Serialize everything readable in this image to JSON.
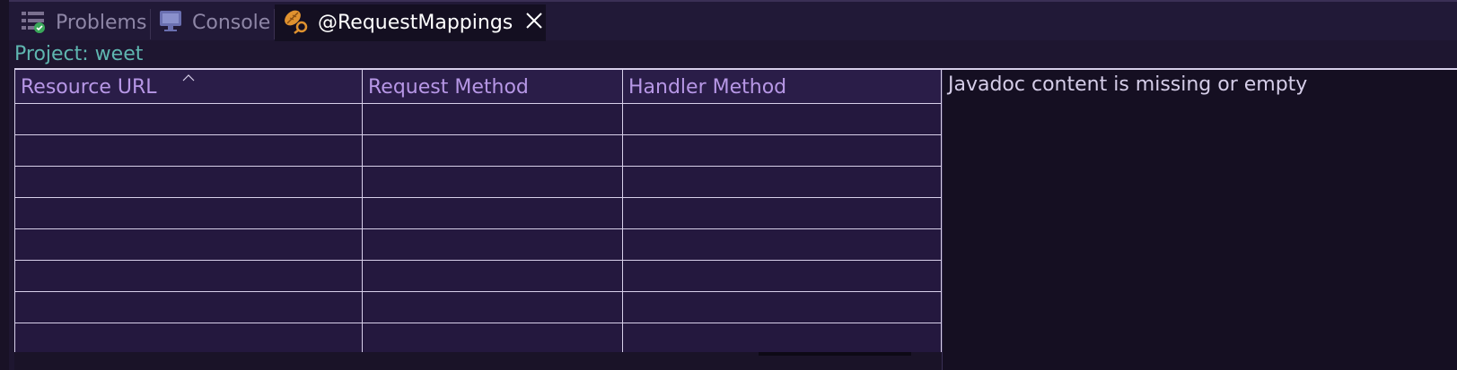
{
  "tabs": [
    {
      "label": "Problems",
      "icon": "problems-list-icon",
      "active": false
    },
    {
      "label": "Console",
      "icon": "console-monitor-icon",
      "active": false
    },
    {
      "label": "@RequestMappings",
      "icon": "spring-leaf-icon",
      "active": true,
      "closable": true
    }
  ],
  "project_label": "Project: weet",
  "table": {
    "columns": [
      "Resource URL",
      "Request Method",
      "Handler Method"
    ],
    "sorted_column": "Resource URL",
    "rows": [
      [
        "",
        "",
        ""
      ],
      [
        "",
        "",
        ""
      ],
      [
        "",
        "",
        ""
      ],
      [
        "",
        "",
        ""
      ],
      [
        "",
        "",
        ""
      ],
      [
        "",
        "",
        ""
      ],
      [
        "",
        "",
        ""
      ],
      [
        "",
        "",
        ""
      ]
    ]
  },
  "javadoc": {
    "text": "Javadoc content is missing or empty"
  },
  "colors": {
    "background": "#1e1630",
    "header_text": "#b797e6",
    "project_text": "#5fb6b0",
    "active_tab_bg": "#140f21"
  }
}
